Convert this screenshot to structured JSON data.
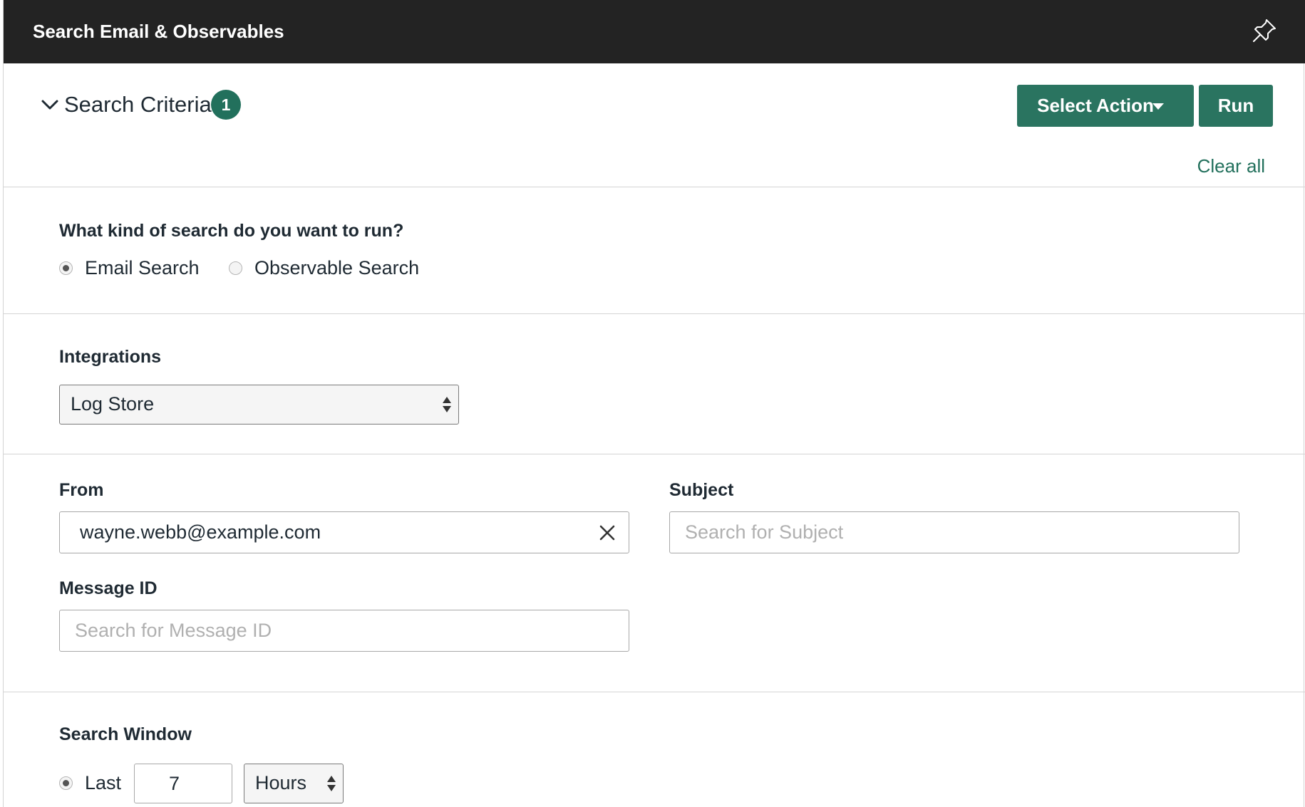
{
  "header": {
    "title": "Search Email & Observables",
    "pin_icon": "pin-icon"
  },
  "criteria": {
    "title": "Search Criteria",
    "count": "1",
    "select_action_label": "Select Action",
    "run_label": "Run",
    "clear_all_label": "Clear all"
  },
  "search_kind": {
    "question": "What kind of search do you want to run?",
    "options": [
      {
        "label": "Email Search",
        "checked": true
      },
      {
        "label": "Observable Search",
        "checked": false
      }
    ]
  },
  "integrations": {
    "label": "Integrations",
    "selected": "Log Store"
  },
  "fields": {
    "from": {
      "label": "From",
      "value": "wayne.webb@example.com"
    },
    "subject": {
      "label": "Subject",
      "placeholder": "Search for Subject"
    },
    "message_id": {
      "label": "Message ID",
      "placeholder": "Search for Message ID"
    }
  },
  "search_window": {
    "label": "Search Window",
    "option_label": "Last",
    "value": "7",
    "unit": "Hours"
  },
  "colors": {
    "header_bg": "#232323",
    "accent": "#2a7460"
  }
}
